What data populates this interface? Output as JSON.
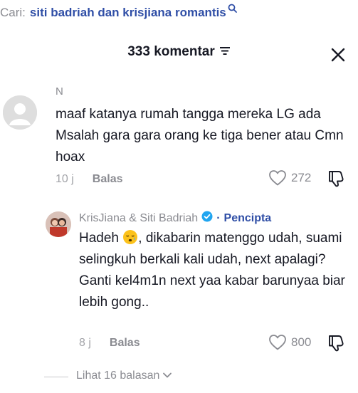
{
  "search": {
    "label": "Cari:",
    "query": "siti badriah dan krisjiana romantis",
    "icon": "search-icon"
  },
  "header": {
    "title": "333 komentar",
    "filter_icon": "filter-icon",
    "close_icon": "close-icon"
  },
  "comments": [
    {
      "username": "N",
      "text": "maaf katanya rumah tangga mereka LG ada Msalah gara gara orang ke tiga bener atau Cmn hoax",
      "time_ago": "10 j",
      "reply_label": "Balas",
      "likes": "272"
    }
  ],
  "reply": {
    "username": "KrisJiana & Siti Badriah",
    "separator": "·",
    "creator_label": "Pencipta",
    "text_before_emoji": "Hadeh",
    "emoji": "sleepy-face-emoji",
    "text_after_emoji": ", dikabarin matenggo udah, suami selingkuh berkali kali udah, next apalagi? Ganti kel4m1n next yaa kabar barunyaa biar lebih gong..",
    "time_ago": "8 j",
    "reply_label": "Balas",
    "likes": "800"
  },
  "view_replies": {
    "label": "Lihat 16 balasan"
  },
  "colors": {
    "link_blue": "#2f4ea6",
    "verified_blue": "#20a5f0",
    "muted_gray": "#8a8b91",
    "text": "#161823"
  }
}
